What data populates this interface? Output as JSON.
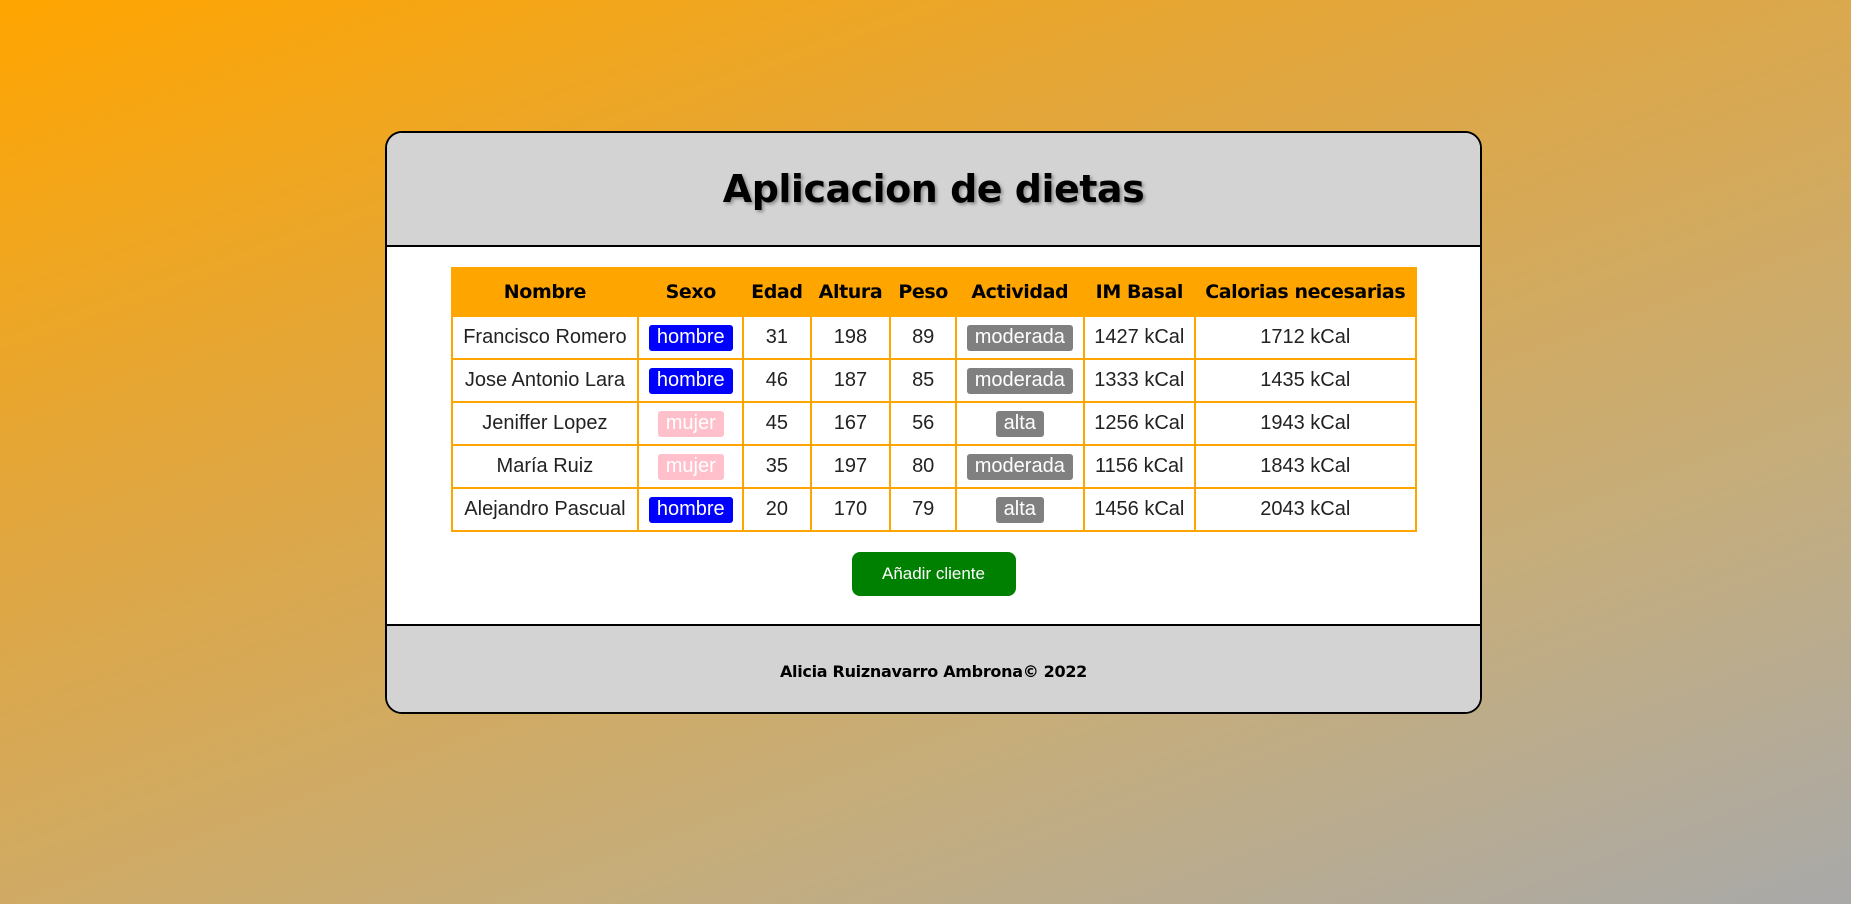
{
  "header": {
    "title": "Aplicacion de dietas"
  },
  "table": {
    "columns": [
      "Nombre",
      "Sexo",
      "Edad",
      "Altura",
      "Peso",
      "Actividad",
      "IM Basal",
      "Calorias necesarias"
    ],
    "rows": [
      {
        "nombre": "Francisco Romero",
        "sexo": "hombre",
        "edad": "31",
        "altura": "198",
        "peso": "89",
        "actividad": "moderada",
        "im_basal": "1427 kCal",
        "calorias": "1712 kCal"
      },
      {
        "nombre": "Jose Antonio Lara",
        "sexo": "hombre",
        "edad": "46",
        "altura": "187",
        "peso": "85",
        "actividad": "moderada",
        "im_basal": "1333 kCal",
        "calorias": "1435 kCal"
      },
      {
        "nombre": "Jeniffer Lopez",
        "sexo": "mujer",
        "edad": "45",
        "altura": "167",
        "peso": "56",
        "actividad": "alta",
        "im_basal": "1256 kCal",
        "calorias": "1943 kCal"
      },
      {
        "nombre": "María Ruiz",
        "sexo": "mujer",
        "edad": "35",
        "altura": "197",
        "peso": "80",
        "actividad": "moderada",
        "im_basal": "1156 kCal",
        "calorias": "1843 kCal"
      },
      {
        "nombre": "Alejandro Pascual",
        "sexo": "hombre",
        "edad": "20",
        "altura": "170",
        "peso": "79",
        "actividad": "alta",
        "im_basal": "1456 kCal",
        "calorias": "2043 kCal"
      }
    ]
  },
  "actions": {
    "add_label": "Añadir cliente"
  },
  "footer": {
    "text": "Alicia Ruiznavarro Ambrona© 2022"
  },
  "colors": {
    "header_bg": "#d3d3d3",
    "table_header_bg": "#ffa500",
    "hombre_badge": "#0000ff",
    "mujer_badge": "#ffc0cb",
    "activity_badge": "#808080",
    "add_button": "#008000"
  }
}
